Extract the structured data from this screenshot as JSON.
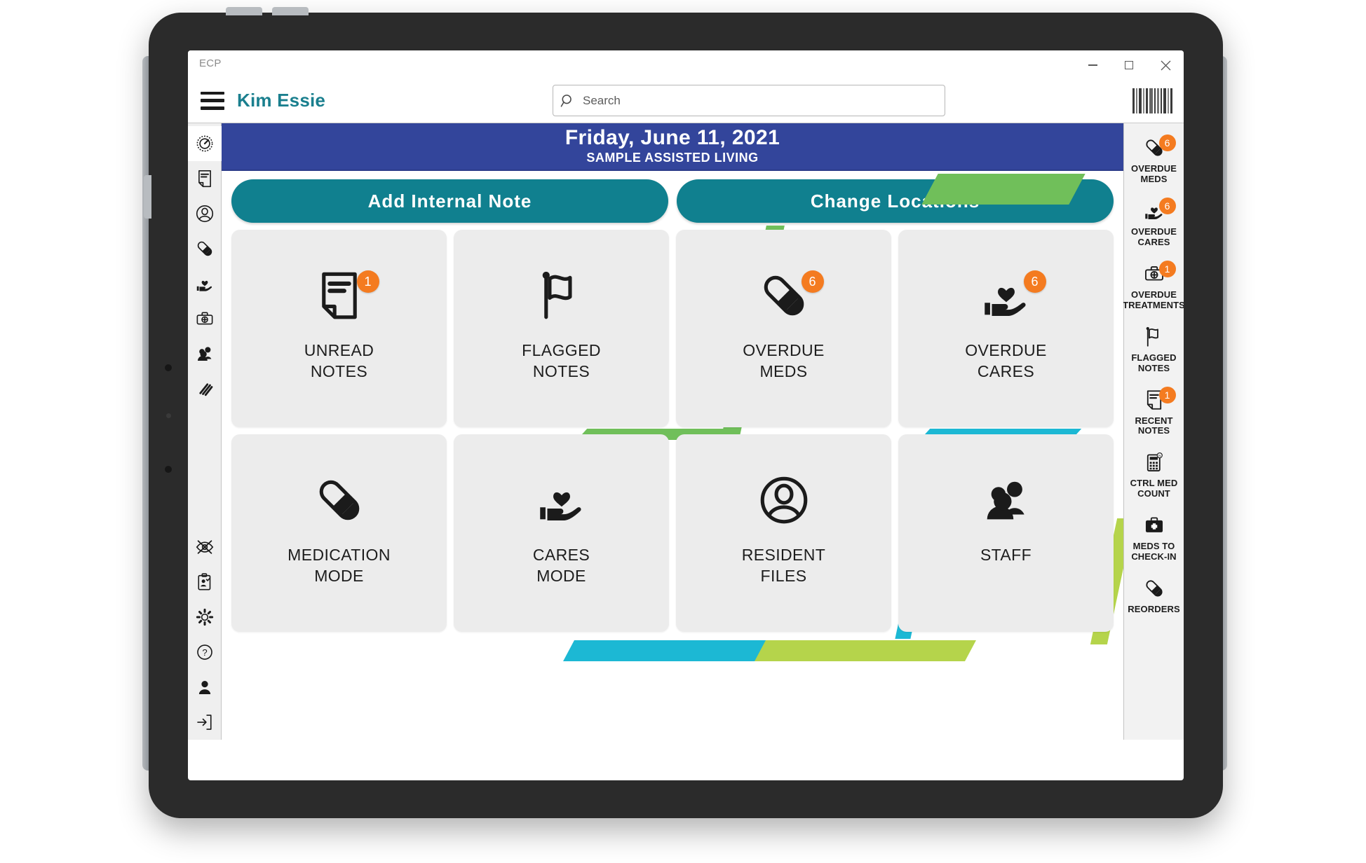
{
  "window": {
    "app_tag": "ECP",
    "minimize_label": "Minimize",
    "maximize_label": "Maximize",
    "close_label": "Close"
  },
  "header": {
    "menu_label": "Menu",
    "user_name": "Kim Essie",
    "search_placeholder": "Search",
    "search_value": "",
    "barcode_label": "Scan barcode"
  },
  "datebar": {
    "date": "Friday, June 11, 2021",
    "facility": "SAMPLE ASSISTED LIVING"
  },
  "actions": {
    "add_note": "Add  Internal  Note",
    "change_locations": "Change  Locations"
  },
  "tiles": [
    {
      "icon": "note-icon",
      "line1": "UNREAD",
      "line2": "NOTES",
      "badge": "1"
    },
    {
      "icon": "flag-icon",
      "line1": "FLAGGED",
      "line2": "NOTES",
      "badge": ""
    },
    {
      "icon": "pill-icon",
      "line1": "OVERDUE",
      "line2": "MEDS",
      "badge": "6"
    },
    {
      "icon": "hand-heart-icon",
      "line1": "OVERDUE",
      "line2": "CARES",
      "badge": "6"
    },
    {
      "icon": "pill-icon",
      "line1": "MEDICATION",
      "line2": "MODE",
      "badge": ""
    },
    {
      "icon": "hand-heart-icon",
      "line1": "CARES",
      "line2": "MODE",
      "badge": ""
    },
    {
      "icon": "person-circle-icon",
      "line1": "RESIDENT",
      "line2": "FILES",
      "badge": ""
    },
    {
      "icon": "people-icon",
      "line1": "STAFF",
      "line2": "",
      "badge": ""
    }
  ],
  "right_rail": [
    {
      "icon": "pill-icon",
      "line1": "OVERDUE",
      "line2": "MEDS",
      "badge": "6"
    },
    {
      "icon": "hand-heart-icon",
      "line1": "OVERDUE",
      "line2": "CARES",
      "badge": "6"
    },
    {
      "icon": "medkit-icon",
      "line1": "OVERDUE",
      "line2": "TREATMENTS",
      "badge": "1"
    },
    {
      "icon": "flag-icon",
      "line1": "FLAGGED",
      "line2": "NOTES",
      "badge": ""
    },
    {
      "icon": "note-icon",
      "line1": "RECENT",
      "line2": "NOTES",
      "badge": "1"
    },
    {
      "icon": "calculator-icon",
      "line1": "CTRL MED",
      "line2": "COUNT",
      "badge": ""
    },
    {
      "icon": "firstaid-icon",
      "line1": "MEDS TO",
      "line2": "CHECK-IN",
      "badge": ""
    },
    {
      "icon": "pill-icon",
      "line1": "REORDERS",
      "line2": "",
      "badge": ""
    }
  ],
  "left_rail": [
    {
      "icon": "gauge-icon",
      "label": "Dashboard",
      "active": true
    },
    {
      "icon": "note-icon",
      "label": "Notes",
      "active": false
    },
    {
      "icon": "person-circle-icon",
      "label": "Residents",
      "active": false
    },
    {
      "icon": "pill-icon",
      "label": "Medications",
      "active": false
    },
    {
      "icon": "hand-heart-icon",
      "label": "Cares",
      "active": false
    },
    {
      "icon": "medkit-icon",
      "label": "Treatments",
      "active": false
    },
    {
      "icon": "people-icon",
      "label": "Staff",
      "active": false
    },
    {
      "icon": "reports-icon",
      "label": "Reports",
      "active": false
    },
    {
      "icon": "eye-off-icon",
      "label": "Hide",
      "active": false
    },
    {
      "icon": "clipboard-user-icon",
      "label": "Audit",
      "active": false
    },
    {
      "icon": "gear-icon",
      "label": "Settings",
      "active": false
    },
    {
      "icon": "help-icon",
      "label": "Help",
      "active": false
    },
    {
      "icon": "user-icon",
      "label": "Profile",
      "active": false
    },
    {
      "icon": "logout-icon",
      "label": "Log out",
      "active": false
    }
  ],
  "colors": {
    "brand_teal": "#1a7f8e",
    "button_teal": "#10808f",
    "banner_blue": "#33459b",
    "badge_orange": "#f47b20",
    "stripe_green": "#70bf5a",
    "stripe_cyan": "#1cb8d4",
    "stripe_lime": "#b5d44b",
    "tile_gray": "#ececec"
  }
}
